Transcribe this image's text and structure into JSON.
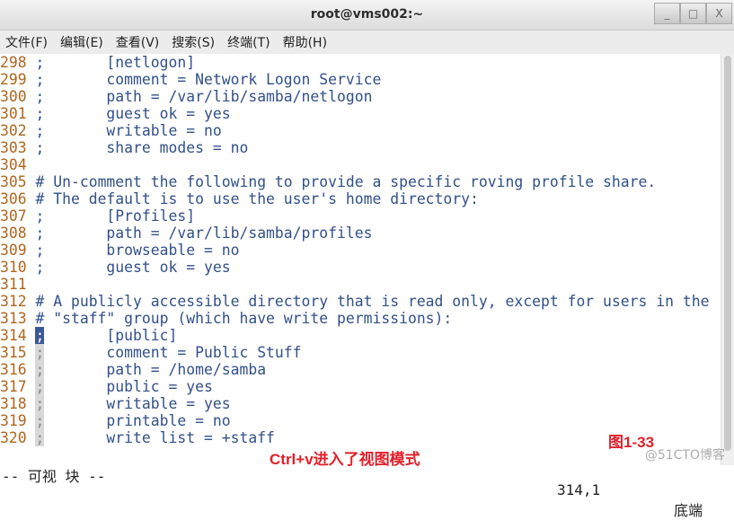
{
  "window": {
    "title": "root@vms002:~",
    "buttons": [
      "_",
      "□",
      "X"
    ]
  },
  "menu": [
    "文件(F)",
    "编辑(E)",
    "查看(V)",
    "搜索(S)",
    "终端(T)",
    "帮助(H)"
  ],
  "lines": [
    {
      "n": "298",
      "p": ";",
      "t": "       [netlogon]"
    },
    {
      "n": "299",
      "p": ";",
      "t": "       comment = Network Logon Service"
    },
    {
      "n": "300",
      "p": ";",
      "t": "       path = /var/lib/samba/netlogon"
    },
    {
      "n": "301",
      "p": ";",
      "t": "       guest ok = yes"
    },
    {
      "n": "302",
      "p": ";",
      "t": "       writable = no"
    },
    {
      "n": "303",
      "p": ";",
      "t": "       share modes = no"
    },
    {
      "n": "304",
      "p": "",
      "t": ""
    },
    {
      "n": "305",
      "p": "#",
      "t": " Un-comment the following to provide a specific roving profile share."
    },
    {
      "n": "306",
      "p": "#",
      "t": " The default is to use the user's home directory:"
    },
    {
      "n": "307",
      "p": ";",
      "t": "       [Profiles]"
    },
    {
      "n": "308",
      "p": ";",
      "t": "       path = /var/lib/samba/profiles"
    },
    {
      "n": "309",
      "p": ";",
      "t": "       browseable = no"
    },
    {
      "n": "310",
      "p": ";",
      "t": "       guest ok = yes"
    },
    {
      "n": "311",
      "p": "",
      "t": ""
    },
    {
      "n": "312",
      "p": "#",
      "t": " A publicly accessible directory that is read only, except for users in the"
    },
    {
      "n": "313",
      "p": "#",
      "t": " \"staff\" group (which have write permissions):"
    },
    {
      "n": "314",
      "p": ";",
      "t": "       [public]",
      "s": "sel"
    },
    {
      "n": "315",
      "p": ";",
      "t": "       comment = Public Stuff",
      "s": "gut"
    },
    {
      "n": "316",
      "p": ";",
      "t": "       path = /home/samba",
      "s": "gut"
    },
    {
      "n": "317",
      "p": ";",
      "t": "       public = yes",
      "s": "gut"
    },
    {
      "n": "318",
      "p": ";",
      "t": "       writable = yes",
      "s": "gut"
    },
    {
      "n": "319",
      "p": ";",
      "t": "       printable = no",
      "s": "gut"
    },
    {
      "n": "320",
      "p": ";",
      "t": "       write list = +staff",
      "s": "gut"
    }
  ],
  "status": {
    "mode": "-- 可视 块 --",
    "position": "314,1",
    "scroll": "底端"
  },
  "annotations": {
    "caption": "Ctrl+v进入了视图模式",
    "figure": "图1-33",
    "watermark": "@51CTO博客"
  }
}
